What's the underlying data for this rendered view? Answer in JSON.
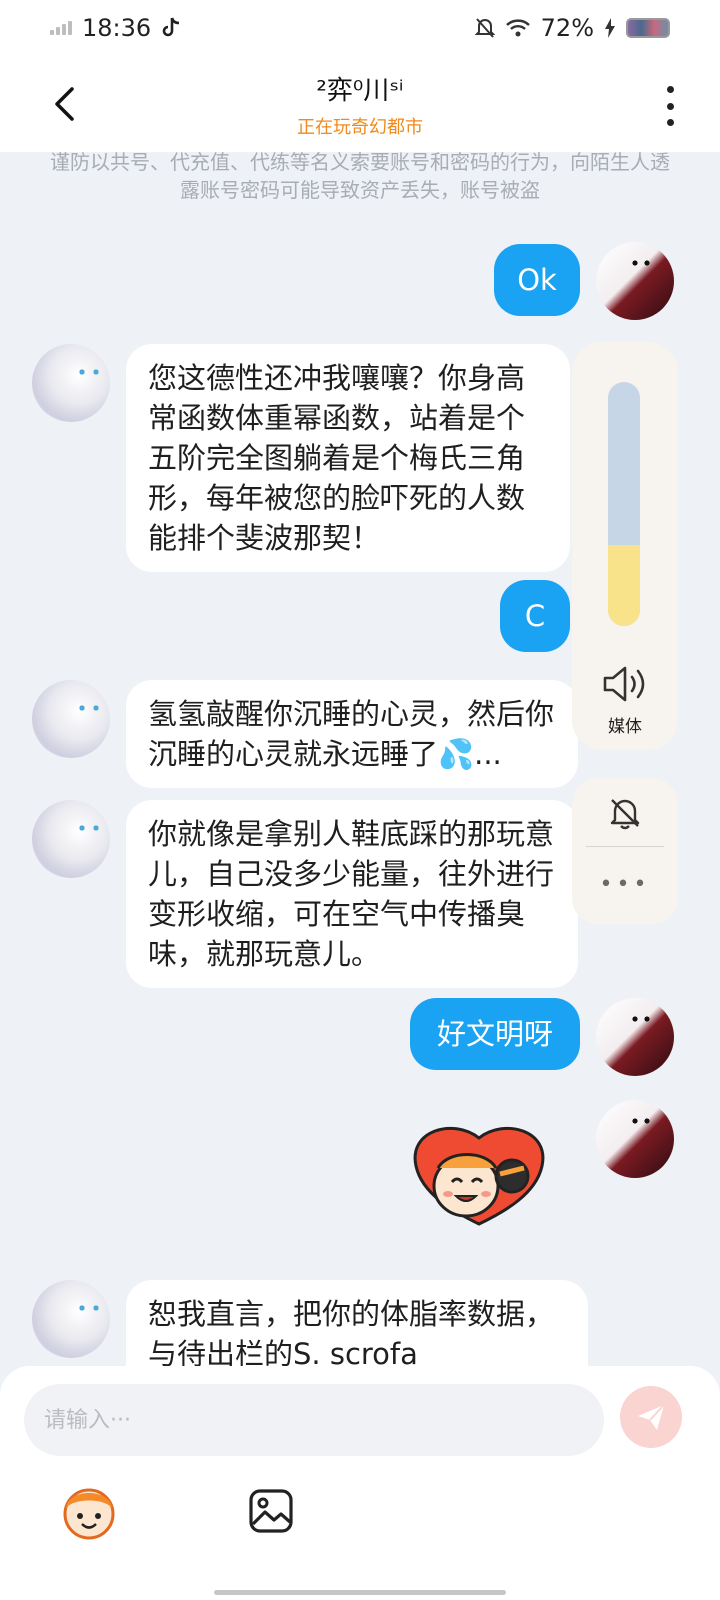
{
  "status_bar": {
    "time": "18:36",
    "battery": "72%",
    "app_icon": "tiktok-icon",
    "icons": [
      "signal-icon",
      "mute-icon",
      "wifi-icon",
      "charging-icon"
    ]
  },
  "header": {
    "title": "²弈⁰川ˢⁱ",
    "status": "正在玩奇幻都市",
    "status_color": "#f08a1c"
  },
  "notice": "谨防以共号、代充值、代练等名义索要账号和密码的行为，向陌生人透露账号密码可能导致资产丢失，账号被盗",
  "messages": [
    {
      "from": "self",
      "type": "text",
      "text": "Ok"
    },
    {
      "from": "other",
      "type": "text",
      "text": "您这德性还冲我嚷嚷？你身高常函数体重幂函数，站着是个五阶完全图躺着是个梅氏三角形，每年被您的脸吓死的人数能排个斐波那契！"
    },
    {
      "from": "self",
      "type": "text",
      "text": "C"
    },
    {
      "from": "other",
      "type": "text",
      "text": "氢氢敲醒你沉睡的心灵，然后你沉睡的心灵就永远睡了💦..."
    },
    {
      "from": "other",
      "type": "text",
      "text": "你就像是拿别人鞋底踩的那玩意儿，自己没多少能量，往外进行变形收缩，可在空气中传播臭味，就那玩意儿。"
    },
    {
      "from": "self",
      "type": "text",
      "text": "好文明呀"
    },
    {
      "from": "self",
      "type": "sticker",
      "icon": "cartoon-sticker"
    },
    {
      "from": "other",
      "type": "text",
      "text": "恕我直言，把你的体脂率数据，与待出栏的S. scrofa"
    }
  ],
  "volume_panel": {
    "level": 0.33,
    "label": "媒体",
    "track_color": "#c7d6e6",
    "fill_color": "#f8e28a"
  },
  "input": {
    "placeholder": "请输入···",
    "value": ""
  },
  "colors": {
    "outgoing_bubble": "#1aa2f3",
    "incoming_bubble": "#ffffff",
    "background": "#eef1f6"
  }
}
